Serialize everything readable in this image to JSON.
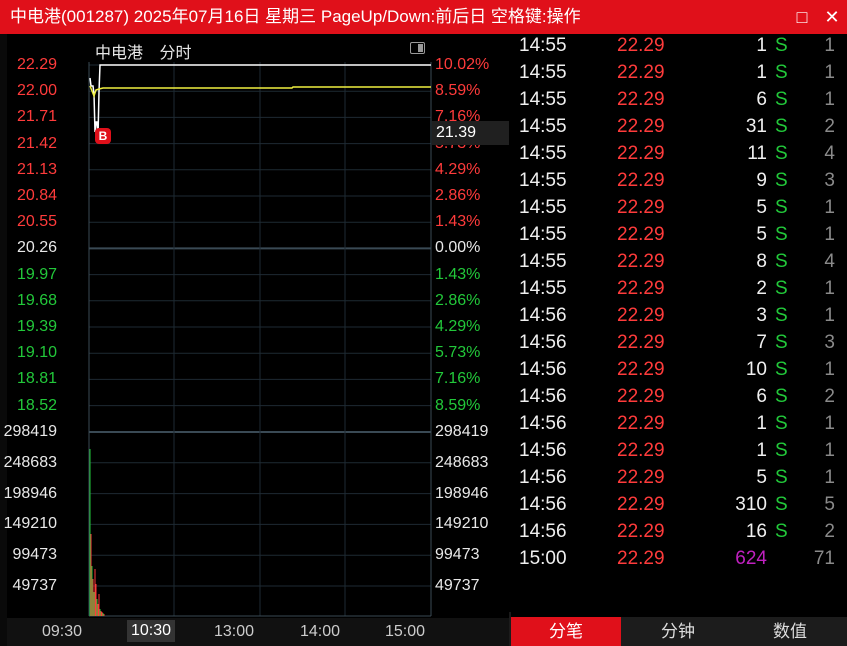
{
  "window": {
    "title": "中电港(001287) 2025年07月16日 星期三 PageUp/Down:前后日 空格键:操作",
    "maximize_icon": "□",
    "close_icon": "✕"
  },
  "chart": {
    "stock_name": "中电港",
    "mode": "分时",
    "current_price": "21.39",
    "buy_marker": "B",
    "price_labels": [
      "22.29",
      "22.00",
      "21.71",
      "21.42",
      "21.13",
      "20.84",
      "20.55",
      "20.26",
      "19.97",
      "19.68",
      "19.39",
      "19.10",
      "18.81",
      "18.52"
    ],
    "pct_labels": [
      "10.02%",
      "8.59%",
      "7.16%",
      "5.73%",
      "4.29%",
      "2.86%",
      "1.43%",
      "0.00%",
      "1.43%",
      "2.86%",
      "4.29%",
      "5.73%",
      "7.16%",
      "8.59%"
    ],
    "volume_labels": [
      "298419",
      "248683",
      "198946",
      "149210",
      "99473",
      "49737"
    ],
    "time_labels": [
      "09:30",
      "10:30",
      "13:00",
      "14:00",
      "15:00"
    ],
    "colors": {
      "up": "#ff3b3b",
      "down": "#22c83a",
      "avg_line": "#f0f040",
      "price_line": "#ffffff"
    }
  },
  "ticks": [
    {
      "time": "14:55",
      "price": "22.29",
      "vol": "1",
      "bs": "S",
      "cnt": "1"
    },
    {
      "time": "14:55",
      "price": "22.29",
      "vol": "1",
      "bs": "S",
      "cnt": "1"
    },
    {
      "time": "14:55",
      "price": "22.29",
      "vol": "6",
      "bs": "S",
      "cnt": "1"
    },
    {
      "time": "14:55",
      "price": "22.29",
      "vol": "31",
      "bs": "S",
      "cnt": "2"
    },
    {
      "time": "14:55",
      "price": "22.29",
      "vol": "11",
      "bs": "S",
      "cnt": "4"
    },
    {
      "time": "14:55",
      "price": "22.29",
      "vol": "9",
      "bs": "S",
      "cnt": "3"
    },
    {
      "time": "14:55",
      "price": "22.29",
      "vol": "5",
      "bs": "S",
      "cnt": "1"
    },
    {
      "time": "14:55",
      "price": "22.29",
      "vol": "5",
      "bs": "S",
      "cnt": "1"
    },
    {
      "time": "14:55",
      "price": "22.29",
      "vol": "8",
      "bs": "S",
      "cnt": "4"
    },
    {
      "time": "14:55",
      "price": "22.29",
      "vol": "2",
      "bs": "S",
      "cnt": "1"
    },
    {
      "time": "14:56",
      "price": "22.29",
      "vol": "3",
      "bs": "S",
      "cnt": "1"
    },
    {
      "time": "14:56",
      "price": "22.29",
      "vol": "7",
      "bs": "S",
      "cnt": "3"
    },
    {
      "time": "14:56",
      "price": "22.29",
      "vol": "10",
      "bs": "S",
      "cnt": "1"
    },
    {
      "time": "14:56",
      "price": "22.29",
      "vol": "6",
      "bs": "S",
      "cnt": "2"
    },
    {
      "time": "14:56",
      "price": "22.29",
      "vol": "1",
      "bs": "S",
      "cnt": "1"
    },
    {
      "time": "14:56",
      "price": "22.29",
      "vol": "1",
      "bs": "S",
      "cnt": "1"
    },
    {
      "time": "14:56",
      "price": "22.29",
      "vol": "5",
      "bs": "S",
      "cnt": "1"
    },
    {
      "time": "14:56",
      "price": "22.29",
      "vol": "310",
      "bs": "S",
      "cnt": "5"
    },
    {
      "time": "14:56",
      "price": "22.29",
      "vol": "16",
      "bs": "S",
      "cnt": "2"
    },
    {
      "time": "15:00",
      "price": "22.29",
      "vol": "624",
      "bs": "",
      "cnt": "71",
      "vol_color": "#c020c0"
    }
  ],
  "tabs": [
    {
      "label": "分笔",
      "active": true
    },
    {
      "label": "分钟",
      "active": false
    },
    {
      "label": "数值",
      "active": false
    }
  ]
}
